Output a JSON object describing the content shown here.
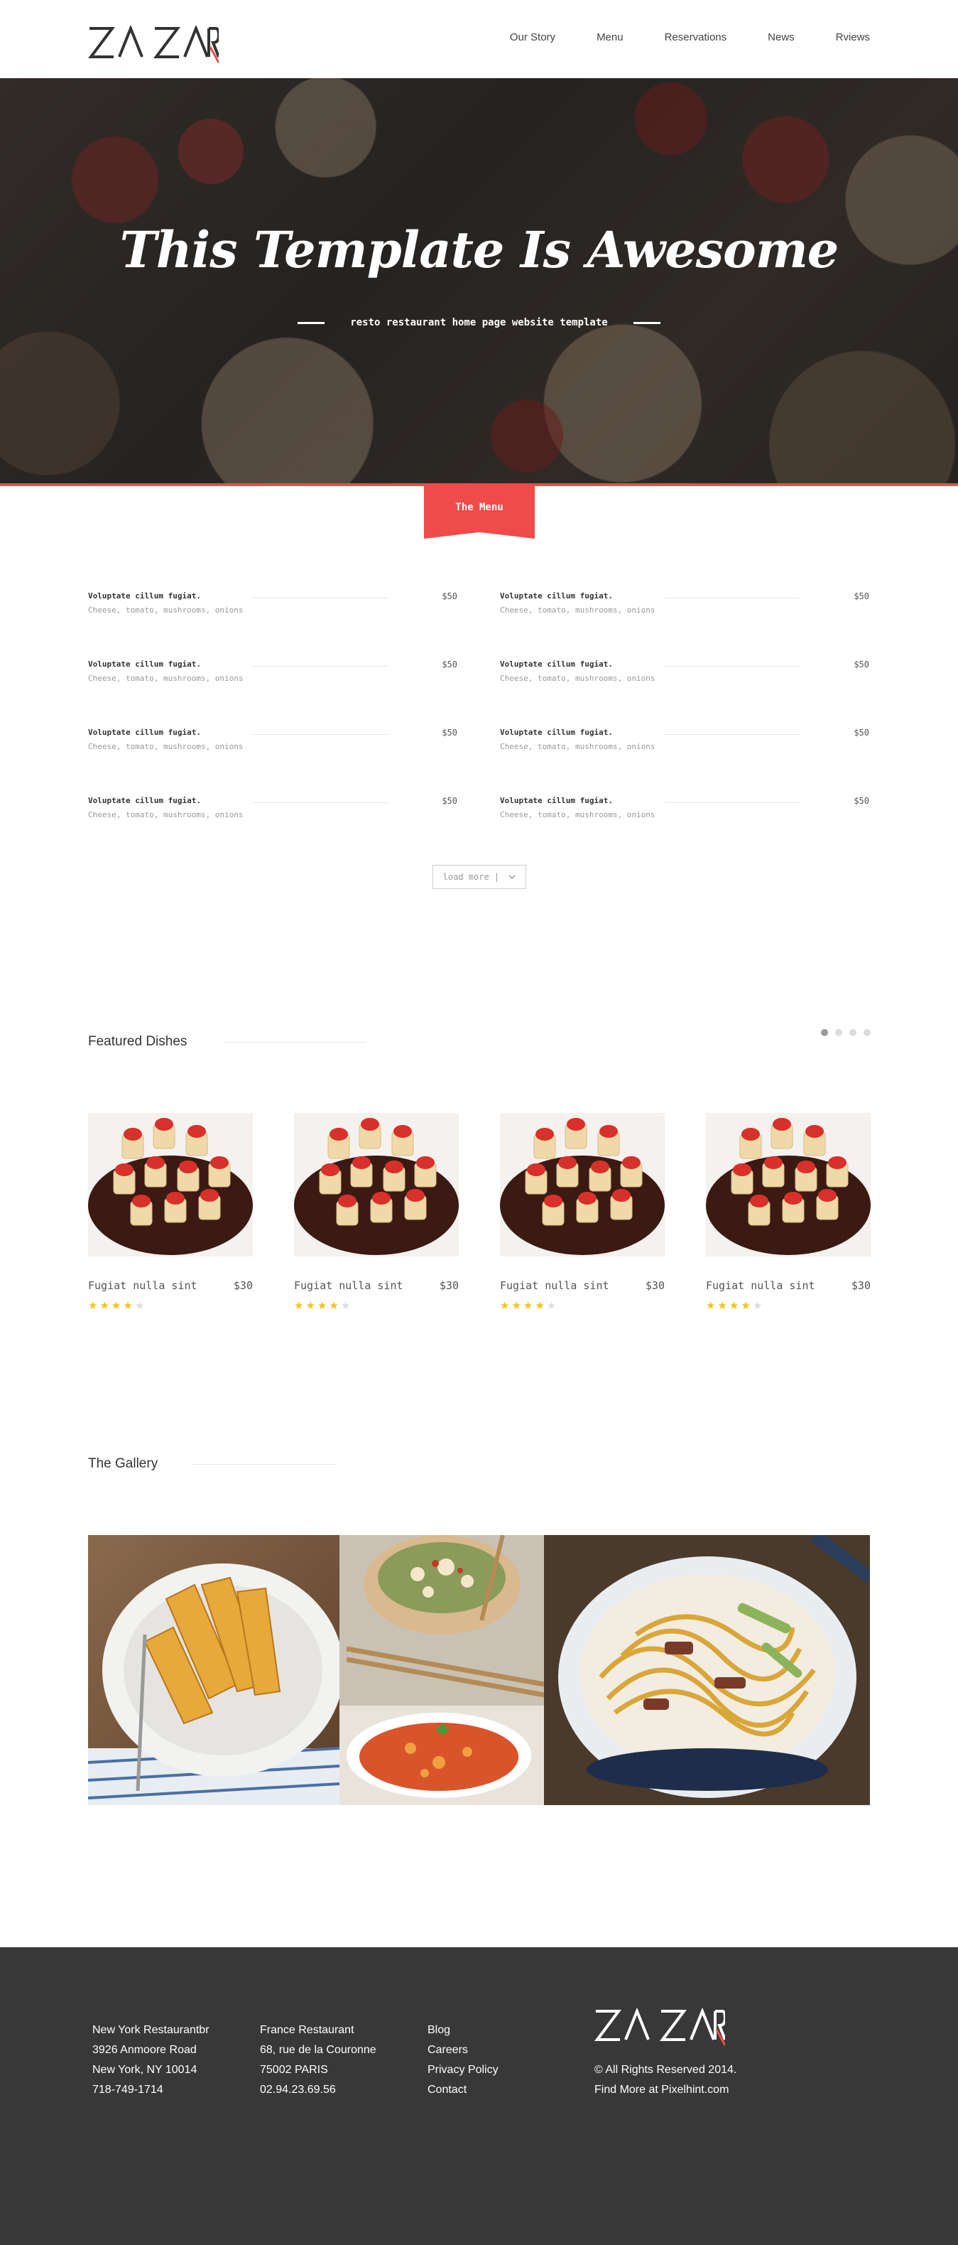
{
  "brand": {
    "logo_text": "ZA ZAR",
    "accent": "#f04a4a"
  },
  "nav": {
    "items": [
      "Our Story",
      "Menu",
      "Reservations",
      "News",
      "Rviews"
    ]
  },
  "hero": {
    "title": "This Template Is Awesome",
    "subtitle": "resto restaurant home page website template"
  },
  "menu_section": {
    "ribbon_label": "The Menu",
    "items": [
      {
        "name": "Voluptate cillum fugiat.",
        "desc": "Cheese, tomato, mushrooms, onions",
        "price": "$50"
      },
      {
        "name": "Voluptate cillum fugiat.",
        "desc": "Cheese, tomato, mushrooms, onions",
        "price": "$50"
      },
      {
        "name": "Voluptate cillum fugiat.",
        "desc": "Cheese, tomato, mushrooms, onions",
        "price": "$50"
      },
      {
        "name": "Voluptate cillum fugiat.",
        "desc": "Cheese, tomato, mushrooms, onions",
        "price": "$50"
      },
      {
        "name": "Voluptate cillum fugiat.",
        "desc": "Cheese, tomato, mushrooms, onions",
        "price": "$50"
      },
      {
        "name": "Voluptate cillum fugiat.",
        "desc": "Cheese, tomato, mushrooms, onions",
        "price": "$50"
      },
      {
        "name": "Voluptate cillum fugiat.",
        "desc": "Cheese, tomato, mushrooms, onions",
        "price": "$50"
      },
      {
        "name": "Voluptate cillum fugiat.",
        "desc": "Cheese, tomato, mushrooms, onions",
        "price": "$50"
      }
    ],
    "load_more": "load more |"
  },
  "featured": {
    "title": "Featured Dishes",
    "carousel_pages": 4,
    "active_page": 1,
    "dishes": [
      {
        "name": "Fugiat nulla sint",
        "price": "$30",
        "rating": 4,
        "max_rating": 5
      },
      {
        "name": "Fugiat nulla sint",
        "price": "$30",
        "rating": 4,
        "max_rating": 5
      },
      {
        "name": "Fugiat nulla sint",
        "price": "$30",
        "rating": 4,
        "max_rating": 5
      },
      {
        "name": "Fugiat nulla sint",
        "price": "$30",
        "rating": 4,
        "max_rating": 5
      }
    ]
  },
  "gallery": {
    "title": "The Gallery"
  },
  "footer": {
    "col1": [
      "New York Restaurantbr",
      "3926 Anmoore Road",
      "New York, NY 10014",
      "718-749-1714"
    ],
    "col2": [
      "France Restaurant",
      "68, rue de la Couronne",
      "75002 PARIS",
      "02.94.23.69.56"
    ],
    "links": [
      "Blog",
      "Careers",
      "Privacy Policy",
      "Contact"
    ],
    "copyright": "© All Rights Reserved 2014.",
    "credit": "Find More at Pixelhint.com"
  }
}
